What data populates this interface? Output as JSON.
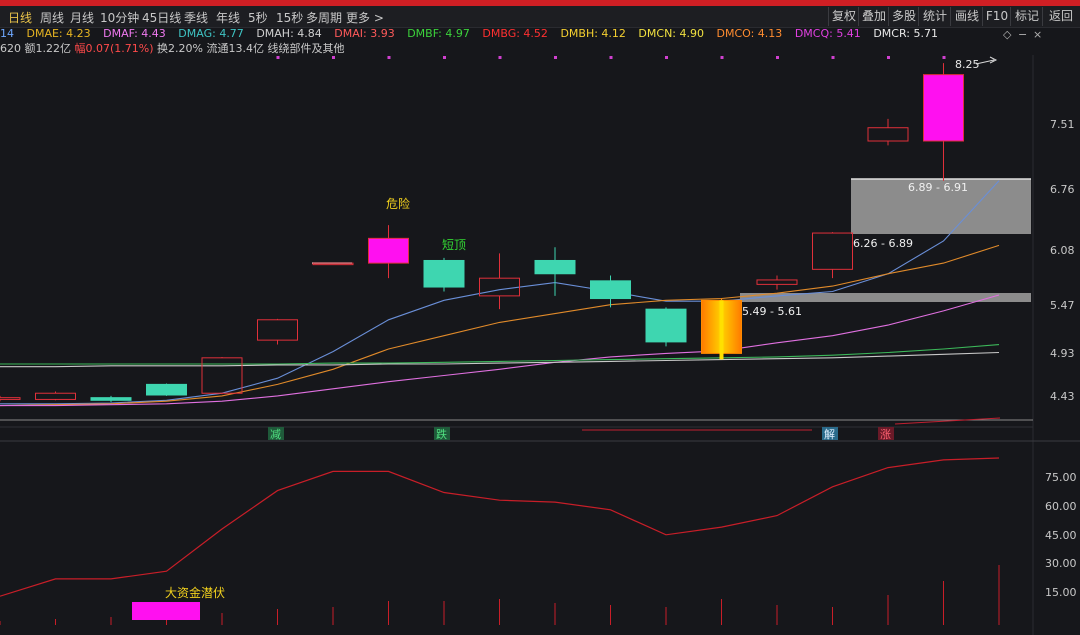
{
  "periods": [
    "日线",
    "周线",
    "月线",
    "10分钟",
    "45日线",
    "季线",
    "年线",
    "5秒",
    "15秒",
    "多周期",
    "更多"
  ],
  "active_period": "日线",
  "right_buttons": [
    "复权",
    "叠加",
    "多股",
    "统计",
    "画线",
    "F10",
    "标记",
    "返回"
  ],
  "indicators_prefix": "14",
  "indicators": [
    {
      "label": "DMAE: 4.23",
      "color": "#e6b422"
    },
    {
      "label": "DMAF: 4.43",
      "color": "#f079f0"
    },
    {
      "label": "DMAG: 4.77",
      "color": "#3fc4c4"
    },
    {
      "label": "DMAH: 4.84",
      "color": "#d0d0d0"
    },
    {
      "label": "DMAI: 3.93",
      "color": "#ff5a5a"
    },
    {
      "label": "DMBF: 4.97",
      "color": "#3cd23c"
    },
    {
      "label": "DMBG: 4.52",
      "color": "#ff3030"
    },
    {
      "label": "DMBH: 4.12",
      "color": "#f5d030"
    },
    {
      "label": "DMCN: 4.90",
      "color": "#f0e040"
    },
    {
      "label": "DMCO: 4.13",
      "color": "#ff8c30"
    },
    {
      "label": "DMCQ: 5.41",
      "color": "#e040e0"
    },
    {
      "label": "DMCR: 5.71",
      "color": "#e8e8e8"
    }
  ],
  "info": {
    "amount": "620 额1.22亿",
    "change": "幅0.07(1.71%)",
    "turnover": "换2.20% 流通13.4亿 线绕部件及其他"
  },
  "controls": {
    "settings": "◇",
    "minus": "−",
    "close": "×"
  },
  "price_axis": [
    "7.51",
    "6.76",
    "6.08",
    "5.47",
    "4.93",
    "4.43"
  ],
  "osc_axis": [
    "75.00",
    "60.00",
    "45.00",
    "30.00",
    "15.00"
  ],
  "annotations": {
    "danger": "危险",
    "short_top": "短顶",
    "peak_price": "8.25",
    "zone_top": "6.89 - 6.91",
    "zone_mid": "6.26 - 6.89",
    "zone_low": "5.49 - 5.61",
    "sig_reduce": "减",
    "sig_fall": "跌",
    "sig_relief": "解",
    "sig_rise": "涨",
    "big_money": "大资金潜伏"
  },
  "colors": {
    "up": "#e0303a",
    "down": "#3ed6b0",
    "magenta": "#ff10f0",
    "bg": "#16171b"
  },
  "candles": [
    {
      "o": 4.4,
      "c": 4.38,
      "h": 4.42,
      "l": 4.36,
      "color": "up"
    },
    {
      "o": 4.38,
      "c": 4.45,
      "h": 4.47,
      "l": 4.37,
      "color": "up"
    },
    {
      "o": 4.4,
      "c": 4.37,
      "h": 4.42,
      "l": 4.35,
      "color": "down"
    },
    {
      "o": 4.43,
      "c": 4.55,
      "h": 4.56,
      "l": 4.42,
      "color": "down"
    },
    {
      "o": 4.45,
      "c": 4.85,
      "h": 4.86,
      "l": 4.44,
      "color": "up"
    },
    {
      "o": 5.05,
      "c": 5.28,
      "h": 5.29,
      "l": 5.0,
      "color": "up"
    },
    {
      "o": 5.92,
      "c": 5.92,
      "h": 5.92,
      "l": 5.92,
      "color": "up"
    },
    {
      "o": 5.92,
      "c": 6.2,
      "h": 6.35,
      "l": 5.75,
      "color": "magenta"
    },
    {
      "o": 5.95,
      "c": 5.65,
      "h": 5.98,
      "l": 5.6,
      "color": "down"
    },
    {
      "o": 5.55,
      "c": 5.75,
      "h": 6.03,
      "l": 5.4,
      "color": "up"
    },
    {
      "o": 5.95,
      "c": 5.8,
      "h": 6.1,
      "l": 5.55,
      "color": "down"
    },
    {
      "o": 5.72,
      "c": 5.52,
      "h": 5.78,
      "l": 5.42,
      "color": "down"
    },
    {
      "o": 5.4,
      "c": 5.03,
      "h": 5.42,
      "l": 4.98,
      "color": "down"
    },
    {
      "o": 5.5,
      "c": 4.9,
      "h": 5.52,
      "l": 4.86,
      "color": "gold"
    },
    {
      "o": 5.68,
      "c": 5.73,
      "h": 5.78,
      "l": 5.62,
      "color": "up"
    },
    {
      "o": 5.85,
      "c": 6.26,
      "h": 6.27,
      "l": 5.75,
      "color": "up"
    },
    {
      "o": 7.3,
      "c": 7.45,
      "h": 7.55,
      "l": 7.25,
      "color": "up"
    },
    {
      "o": 7.3,
      "c": 8.05,
      "h": 8.18,
      "l": 6.85,
      "color": "magenta"
    }
  ],
  "ma_series": [
    {
      "name": "DMCR",
      "color": "#6a8fd8",
      "values": [
        4.33,
        4.33,
        4.34,
        4.37,
        4.45,
        4.62,
        4.92,
        5.28,
        5.5,
        5.62,
        5.7,
        5.6,
        5.49,
        5.49,
        5.55,
        5.6,
        5.8,
        6.17,
        6.85
      ]
    },
    {
      "name": "DMCO",
      "color": "#e08a2a",
      "values": [
        4.31,
        4.32,
        4.33,
        4.36,
        4.42,
        4.55,
        4.72,
        4.95,
        5.1,
        5.25,
        5.35,
        5.45,
        5.5,
        5.52,
        5.58,
        5.66,
        5.8,
        5.92,
        6.12
      ]
    },
    {
      "name": "DMCQ",
      "color": "#e070e0",
      "values": [
        4.31,
        4.31,
        4.32,
        4.33,
        4.36,
        4.42,
        4.5,
        4.58,
        4.65,
        4.72,
        4.8,
        4.86,
        4.9,
        4.93,
        5.02,
        5.1,
        5.22,
        5.38,
        5.56
      ]
    },
    {
      "name": "DMBF",
      "color": "#3cb85a",
      "values": [
        4.78,
        4.78,
        4.78,
        4.78,
        4.78,
        4.78,
        4.79,
        4.79,
        4.8,
        4.81,
        4.82,
        4.83,
        4.84,
        4.85,
        4.86,
        4.88,
        4.91,
        4.95,
        5.0
      ]
    },
    {
      "name": "DMAH",
      "color": "#c8c8c8",
      "values": [
        4.75,
        4.75,
        4.76,
        4.76,
        4.76,
        4.77,
        4.77,
        4.78,
        4.78,
        4.79,
        4.8,
        4.81,
        4.82,
        4.83,
        4.84,
        4.85,
        4.87,
        4.89,
        4.91
      ]
    }
  ],
  "osc_values": [
    15,
    24,
    24,
    28,
    50,
    70,
    80,
    80,
    69,
    65,
    64,
    60,
    47,
    51,
    57,
    72,
    82,
    86,
    87
  ],
  "volume_values": [
    2,
    3,
    4,
    5,
    6,
    8,
    9,
    12,
    12,
    13,
    11,
    10,
    9,
    13,
    10,
    9,
    15,
    22,
    30
  ]
}
